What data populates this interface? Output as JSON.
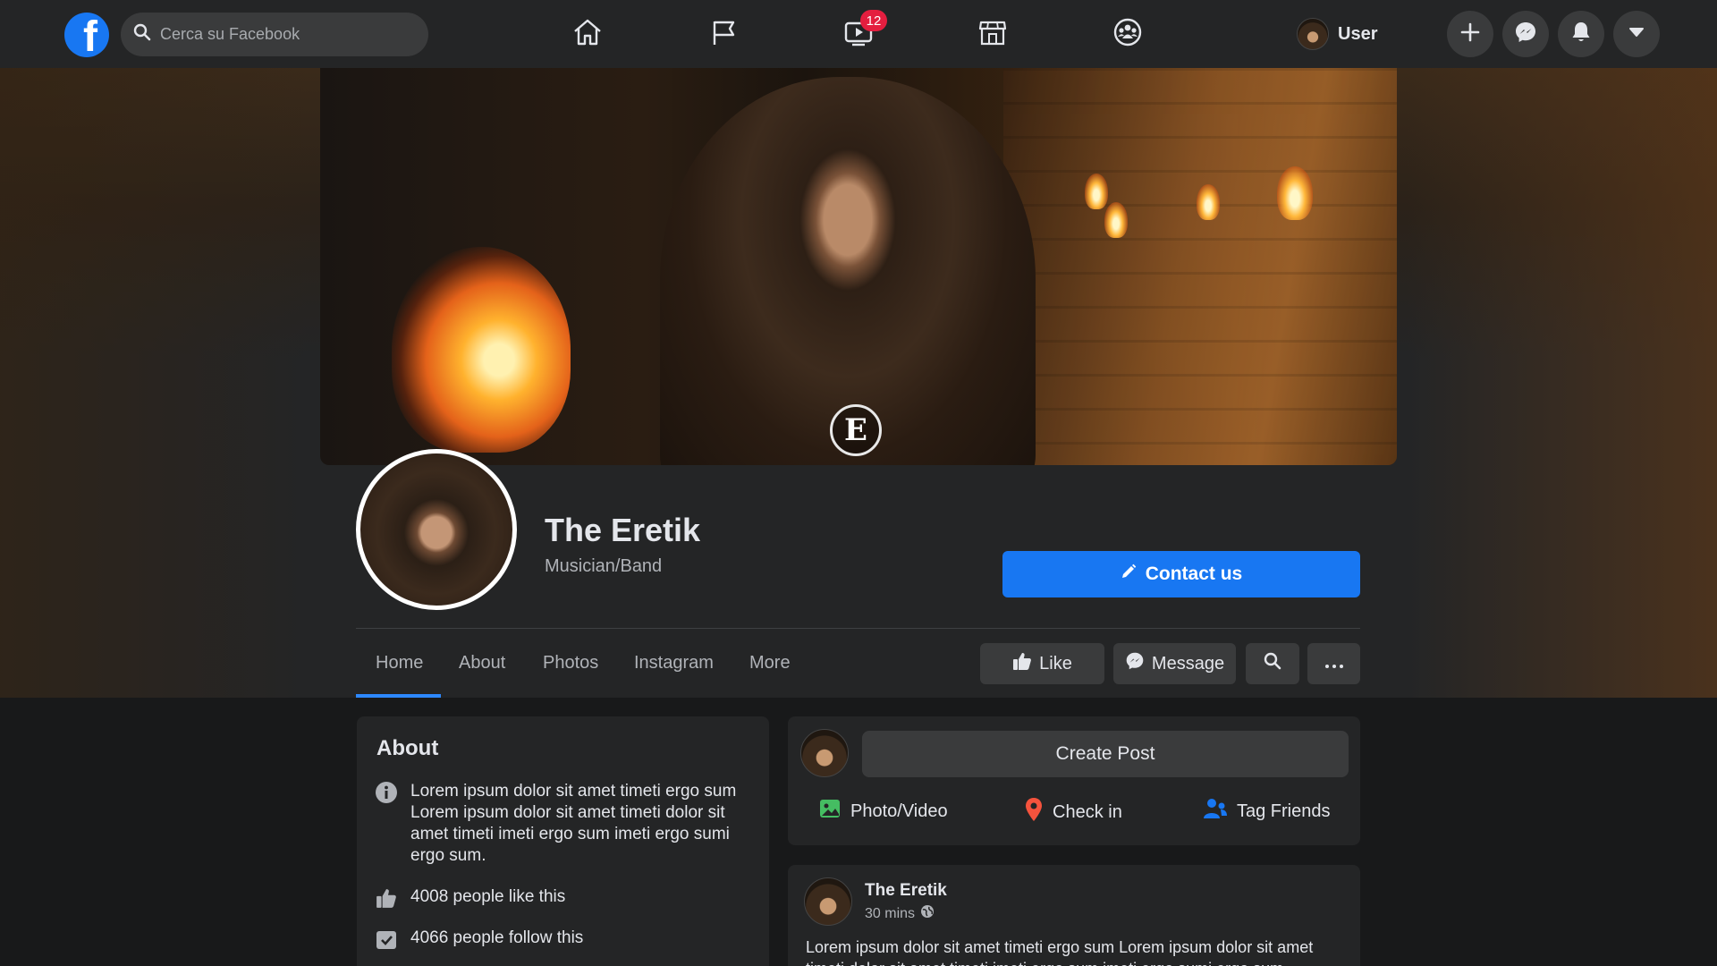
{
  "topbar": {
    "search_placeholder": "Cerca su Facebook",
    "watch_badge": "12",
    "user_name": "User"
  },
  "page": {
    "name": "The Eretik",
    "category": "Musician/Band",
    "contact_label": "Contact us"
  },
  "tabs": [
    "Home",
    "About",
    "Photos",
    "Instagram",
    "More"
  ],
  "actions": {
    "like_label": "Like",
    "message_label": "Message"
  },
  "about": {
    "title": "About",
    "description": "Lorem ipsum dolor sit amet timeti ergo sum Lorem ipsum dolor sit amet timeti dolor sit amet timeti imeti ergo sum imeti ergo sumi ergo sum.",
    "likes": "4008 people like this",
    "follows": "4066 people follow this"
  },
  "composer": {
    "create_post": "Create Post",
    "photo_video": "Photo/Video",
    "check_in": "Check in",
    "tag_friends": "Tag Friends"
  },
  "post": {
    "author": "The Eretik",
    "time": "30 mins",
    "text": "Lorem ipsum dolor sit amet timeti ergo sum Lorem ipsum dolor sit amet timeti dolor sit amet timeti imeti ergo sum imeti ergo sumi ergo sum."
  },
  "colors": {
    "brand": "#1877f2",
    "badge": "#e41e3f",
    "bar": "#242526",
    "background": "#18191a"
  }
}
